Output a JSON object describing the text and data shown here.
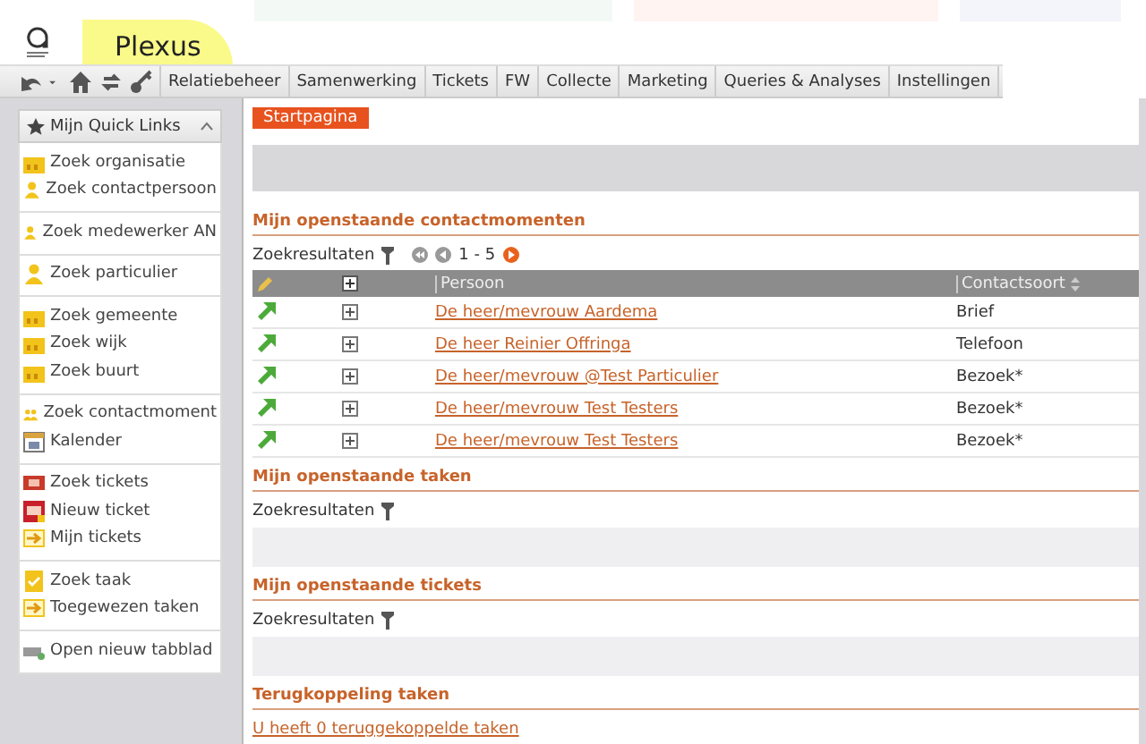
{
  "header": {
    "app_name": "Plexus"
  },
  "menu": [
    {
      "label": "Relatiebeheer"
    },
    {
      "label": "Samenwerking"
    },
    {
      "label": "Tickets"
    },
    {
      "label": "FW"
    },
    {
      "label": "Collecte"
    },
    {
      "label": "Marketing"
    },
    {
      "label": "Queries & Analyses"
    },
    {
      "label": "Instellingen"
    }
  ],
  "quick_links": {
    "title": "Mijn Quick Links",
    "expanded": true,
    "groups": [
      [
        {
          "label": "Zoek organisatie",
          "kind": "building"
        },
        {
          "label": "Zoek contactpersoon",
          "kind": "person"
        }
      ],
      [
        {
          "label": "Zoek medewerker AN",
          "kind": "person"
        }
      ],
      [
        {
          "label": "Zoek particulier",
          "kind": "person"
        }
      ],
      [
        {
          "label": "Zoek gemeente",
          "kind": "building"
        },
        {
          "label": "Zoek wijk",
          "kind": "building"
        },
        {
          "label": "Zoek buurt",
          "kind": "building"
        }
      ],
      [
        {
          "label": "Zoek contactmoment",
          "kind": "people"
        },
        {
          "label": "Kalender",
          "kind": "calendar"
        }
      ],
      [
        {
          "label": "Zoek tickets",
          "kind": "ticket"
        },
        {
          "label": "Nieuw ticket",
          "kind": "new-ticket"
        },
        {
          "label": "Mijn tickets",
          "kind": "arrow"
        }
      ],
      [
        {
          "label": "Zoek taak",
          "kind": "task"
        },
        {
          "label": "Toegewezen taken",
          "kind": "arrow"
        }
      ],
      [
        {
          "label": "Open nieuw tabblad",
          "kind": "tab"
        }
      ]
    ]
  },
  "tabs": [
    {
      "label": "Startpagina",
      "selected": true
    }
  ],
  "sections": [
    {
      "kind": "table",
      "title": "Mijn openstaande contactmomenten",
      "results_label": "Zoekresultaten",
      "pager": "1 - 5",
      "columns": [
        "Persoon",
        "Contactsoort"
      ],
      "rows": [
        {
          "persoon": "De heer/mevrouw Aardema",
          "contactsoort": "Brief"
        },
        {
          "persoon": "De heer Reinier Offringa",
          "contactsoort": "Telefoon"
        },
        {
          "persoon": "De heer/mevrouw @Test Particulier",
          "contactsoort": "Bezoek*"
        },
        {
          "persoon": "De heer/mevrouw Test Testers",
          "contactsoort": "Bezoek*"
        },
        {
          "persoon": "De heer/mevrouw Test Testers",
          "contactsoort": "Bezoek*"
        }
      ]
    },
    {
      "kind": "empty",
      "title": "Mijn openstaande taken",
      "results_label": "Zoekresultaten"
    },
    {
      "kind": "empty",
      "title": "Mijn openstaande tickets",
      "results_label": "Zoekresultaten"
    },
    {
      "kind": "link",
      "title": "Terugkoppeling taken",
      "link": "U heeft 0 teruggekoppelde taken"
    }
  ]
}
